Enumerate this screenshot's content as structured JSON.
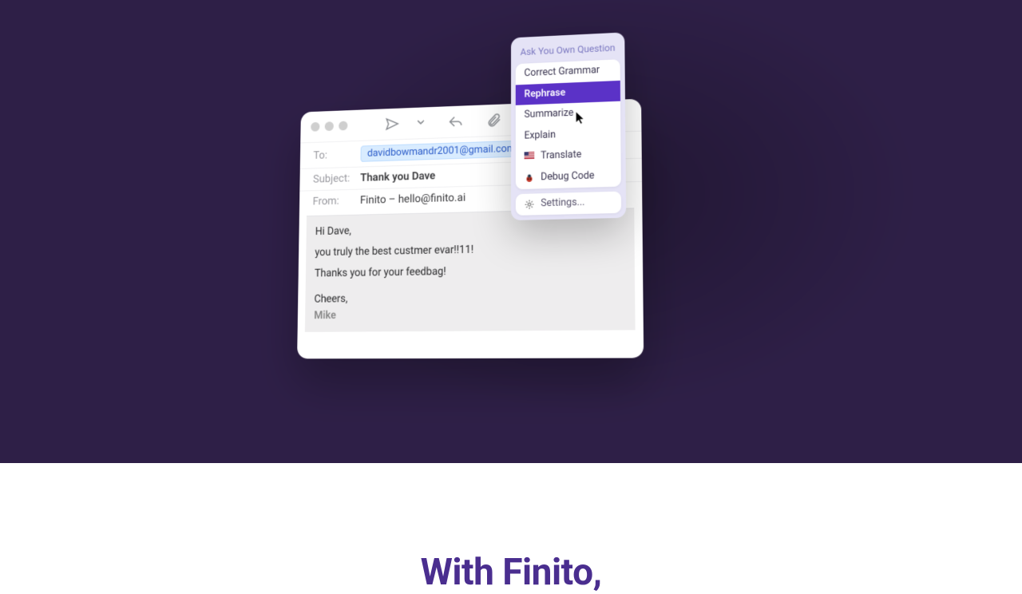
{
  "email": {
    "to_label": "To:",
    "to_chip": "davidbowmandr2001@gmail.com",
    "subject_label": "Subject:",
    "subject_value": "Thank you Dave",
    "from_label": "From:",
    "from_value": "Finito – hello@finito.ai",
    "body_greeting": "Hi Dave,",
    "body_line1": "you truly the best custmer evar!!11!",
    "body_line2": "Thanks you for your feedbag!",
    "body_signoff": "Cheers,",
    "body_name": "Mike"
  },
  "popup": {
    "ask": "Ask You Own Question",
    "items": {
      "correct": "Correct Grammar",
      "rephrase": "Rephrase",
      "summarize": "Summarize",
      "explain": "Explain",
      "translate": "Translate",
      "debug": "Debug Code",
      "settings": "Settings..."
    }
  },
  "page": {
    "headline": "With Finito,"
  }
}
